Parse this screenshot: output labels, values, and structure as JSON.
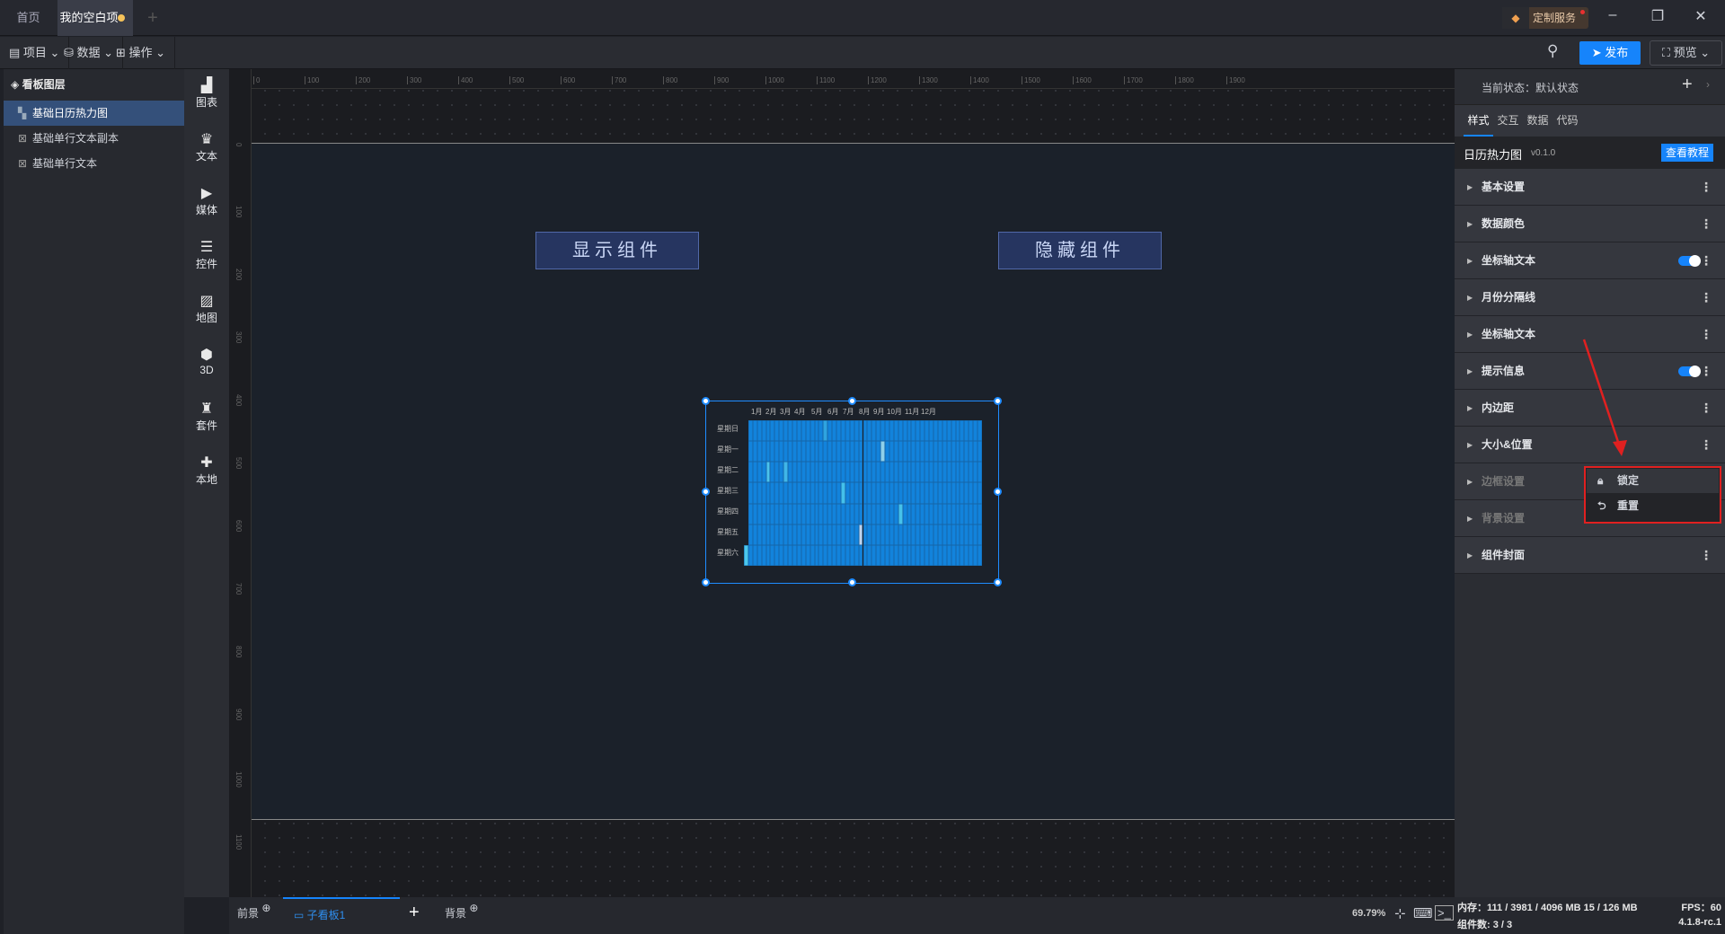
{
  "tabs": [
    {
      "label": "首页"
    },
    {
      "label": "我的空白项目"
    }
  ],
  "titlebar": {
    "service": "定制服务",
    "minimize": "–",
    "restore": "❐",
    "close": "✕"
  },
  "toolbar": {
    "project": "项目",
    "data": "数据",
    "operate": "操作",
    "publish": "发布",
    "preview": "预览"
  },
  "layers": {
    "title": "看板图层",
    "items": [
      "基础日历热力图",
      "基础单行文本副本",
      "基础单行文本"
    ]
  },
  "iconbar": [
    "图表",
    "文本",
    "媒体",
    "控件",
    "地图",
    "3D",
    "套件",
    "本地"
  ],
  "ruler": {
    "h": [
      "0",
      "100",
      "200",
      "300",
      "400",
      "500",
      "600",
      "700",
      "800",
      "900",
      "1000",
      "1100",
      "1200",
      "1300",
      "1400",
      "1500",
      "1600",
      "1700",
      "1800",
      "1900"
    ],
    "v": [
      "0",
      "100",
      "200",
      "300",
      "400",
      "500",
      "600",
      "700",
      "800",
      "900",
      "1000",
      "1100"
    ]
  },
  "canvas": {
    "show_btn": "显示组件",
    "hide_btn": "隐藏组件"
  },
  "heatmap": {
    "months": [
      "1月",
      "2月",
      "3月",
      "4月",
      "5月",
      "6月",
      "7月",
      "8月",
      "9月",
      "10月",
      "11月",
      "12月"
    ],
    "days": [
      "星期日",
      "星期一",
      "星期二",
      "星期三",
      "星期四",
      "星期五",
      "星期六"
    ],
    "base_color": "#1283dc",
    "highlights": [
      [
        18,
        0,
        "#2fa4e0"
      ],
      [
        31,
        1,
        "#8fd0ea"
      ],
      [
        5,
        2,
        "#4cc3ec"
      ],
      [
        9,
        2,
        "#40b6e8"
      ],
      [
        22,
        3,
        "#44c0ea"
      ],
      [
        35,
        4,
        "#46c2ea"
      ],
      [
        26,
        5,
        "#c3d3ea"
      ],
      [
        0,
        6,
        "#4cc8ec"
      ]
    ]
  },
  "right": {
    "state_label": "当前状态：默认状态",
    "tabs": [
      "样式",
      "交互",
      "数据",
      "代码"
    ],
    "component": "日历热力图",
    "version": "v0.1.0",
    "tutorial": "查看教程",
    "sections": [
      {
        "label": "基本设置",
        "toggle": false,
        "disabled": false
      },
      {
        "label": "数据颜色",
        "toggle": false,
        "disabled": false
      },
      {
        "label": "坐标轴文本",
        "toggle": true,
        "disabled": false
      },
      {
        "label": "月份分隔线",
        "toggle": false,
        "disabled": false
      },
      {
        "label": "坐标轴文本",
        "toggle": false,
        "disabled": false
      },
      {
        "label": "提示信息",
        "toggle": true,
        "disabled": false
      },
      {
        "label": "内边距",
        "toggle": false,
        "disabled": false
      },
      {
        "label": "大小&位置",
        "toggle": false,
        "disabled": false
      },
      {
        "label": "边框设置",
        "toggle": false,
        "disabled": true
      },
      {
        "label": "背景设置",
        "toggle": false,
        "disabled": true
      },
      {
        "label": "组件封面",
        "toggle": false,
        "disabled": false
      }
    ],
    "menu": {
      "lock": "锁定",
      "reset": "重置"
    }
  },
  "bottom": {
    "foreground": "前景",
    "subboard": "子看板1",
    "background": "背景",
    "zoom": "69.79%"
  },
  "status": {
    "memory": "内存：111 / 3981 / 4096 MB  15 / 126 MB",
    "fps": "FPS：60",
    "count": "组件数: 3 / 3",
    "version": "4.1.8-rc.1"
  }
}
